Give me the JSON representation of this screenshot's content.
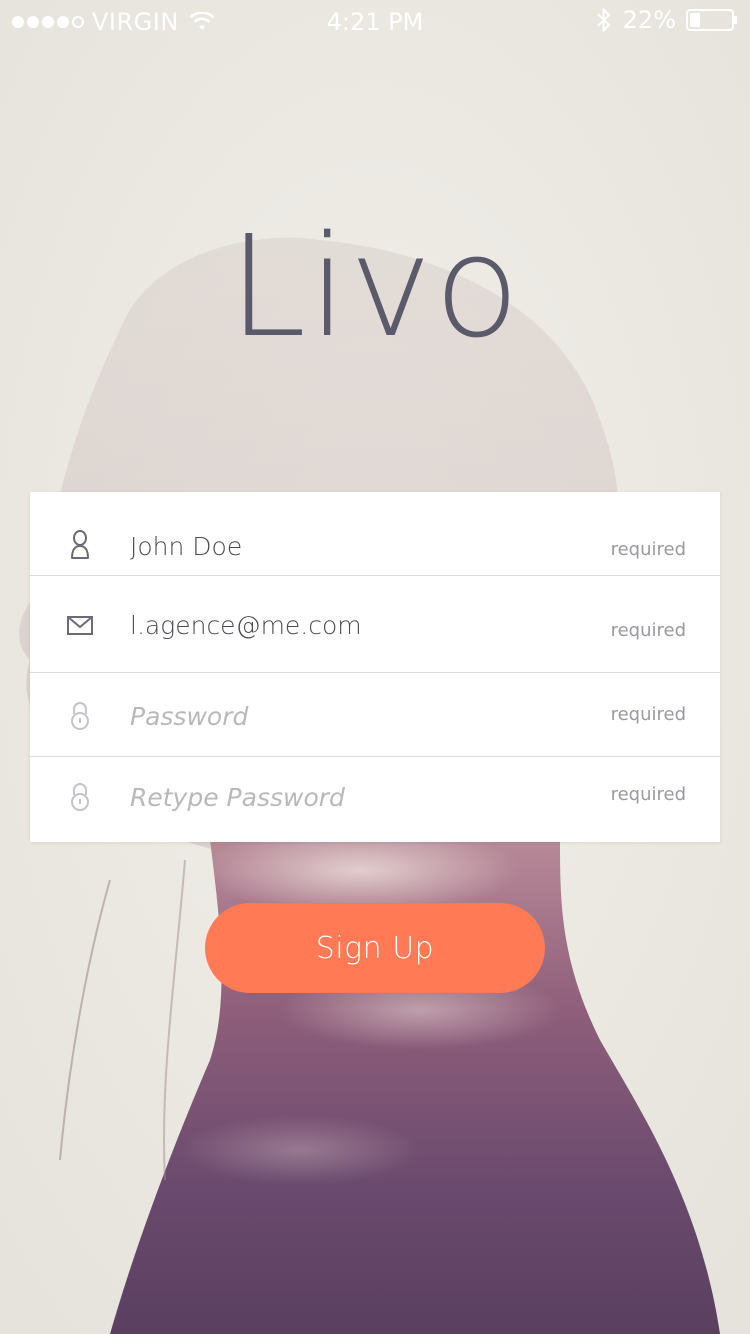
{
  "status_bar": {
    "carrier": "VIRGIN",
    "time": "4:21 PM",
    "battery": "22%",
    "signal_bars_filled": 4,
    "signal_bars_total": 5
  },
  "app": {
    "logo": "Livo"
  },
  "form": {
    "fields": [
      {
        "icon": "user-icon",
        "value": "John Doe",
        "placeholder": "",
        "required_label": "required"
      },
      {
        "icon": "mail-icon",
        "value": "l.agence@me.com",
        "placeholder": "",
        "required_label": "required"
      },
      {
        "icon": "lock-icon",
        "value": "",
        "placeholder": "Password",
        "required_label": "required"
      },
      {
        "icon": "lock-icon",
        "value": "",
        "placeholder": "Retype Password",
        "required_label": "required"
      }
    ]
  },
  "actions": {
    "signup_label": "Sign Up"
  },
  "colors": {
    "accent": "#ff7a55",
    "logo": "#5a5a6b",
    "card": "#ffffff"
  }
}
